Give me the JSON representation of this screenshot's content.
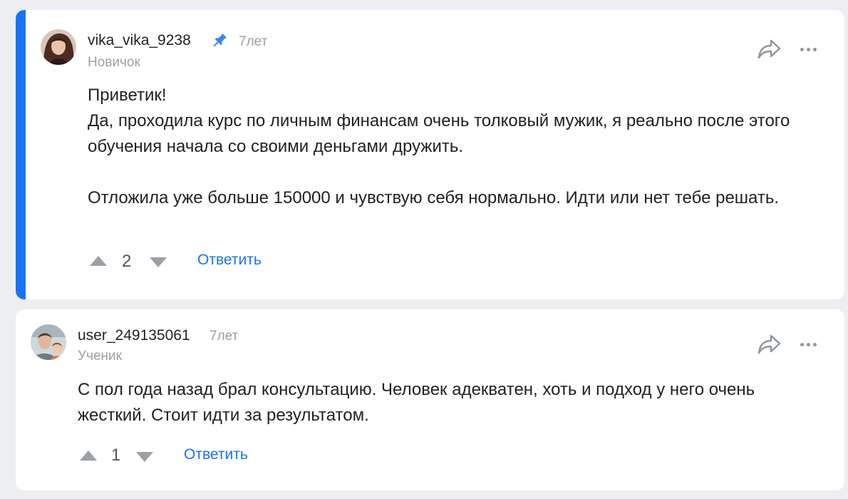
{
  "comments": [
    {
      "username": "vika_vika_9238",
      "age": "7лет",
      "rank": "Новичок",
      "paragraphs": [
        "Приветик!",
        "Да, проходила курс по личным финансам очень толковый мужик, я реально после этого обучения начала со своими деньгами дружить.",
        "Отложила уже больше 150000 и чувствую себя нормально. Идти или нет тебе решать."
      ],
      "votes": "2",
      "reply_label": "Ответить",
      "pinned_icon": "pin-icon",
      "accent_color": "#1a73f5"
    },
    {
      "username": "user_249135061",
      "age": "7лет",
      "rank": "Ученик",
      "paragraphs": [
        "С пол года назад брал консультацию. Человек адекватен, хоть и подход у него очень жесткий. Стоит идти за результатом."
      ],
      "votes": "1",
      "reply_label": "Ответить"
    }
  ],
  "colors": {
    "background": "#eceef1",
    "link": "#1a73e8",
    "muted": "#9aa0a6"
  }
}
